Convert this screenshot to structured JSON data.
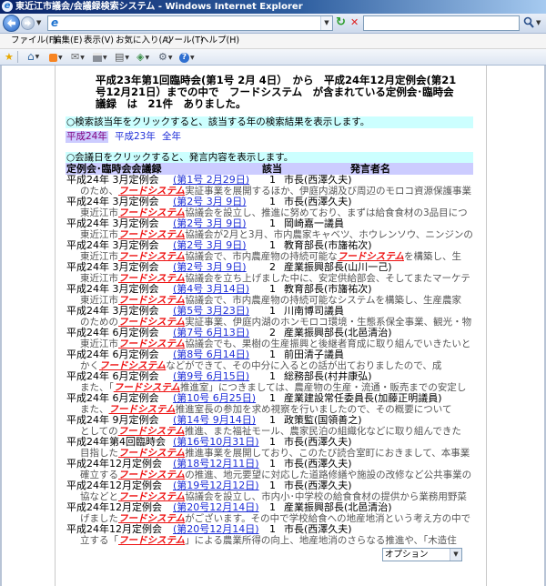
{
  "window": {
    "title": "東近江市議会/会議録検索システム - Windows Internet Explorer"
  },
  "menu": {
    "items": [
      "ファイル(F)",
      "編集(E)",
      "表示(V)",
      "お気に入り(A)",
      "ツール(T)",
      "ヘルプ(H)"
    ]
  },
  "icons": {
    "address_bar": [
      "back-arrow-icon",
      "forward-arrow-icon",
      "ie-page-icon",
      "refresh-icon",
      "stop-icon",
      "search-icon"
    ],
    "command_bar": [
      "favorites-star-icon",
      "home-icon",
      "feeds-icon",
      "read-mail-icon",
      "print-icon",
      "page-icon",
      "safety-icon",
      "tools-icon",
      "help-icon"
    ]
  },
  "colors": {
    "title_bar": "#0a246a",
    "note_bg": "#ccffff",
    "header_bg": "#ccccff",
    "selected_year_bg": "#ccccff",
    "link": "#1f2fd8",
    "visited_link": "#800080",
    "keyword": "#ee1111",
    "snippet": "#555555"
  },
  "search": {
    "keyword": "フードシステム"
  },
  "summary": {
    "lines": [
      "平成23年第1回臨時会(第1号 2月 4日）　から　平成24年12月定例会(第21",
      "号12月21日）までの中で　フードシステム　が含まれている定例会･臨時会",
      "議録　は　21件　ありました。"
    ]
  },
  "year_filter": {
    "note": "○検索該当年をクリックすると、該当する年の検索結果を表示します。",
    "years": [
      {
        "label": "平成24年",
        "selected": true
      },
      {
        "label": "平成23年",
        "selected": false
      },
      {
        "label": "全年",
        "selected": false
      }
    ]
  },
  "results": {
    "note": "○会議日をクリックすると、発言内容を表示します。",
    "columns": [
      "定例会･臨時会会議録",
      "該当",
      "発言者名"
    ],
    "rows": [
      {
        "meeting": "平成24年 3月定例会",
        "date": "(第1号 2月29日)",
        "count": 1,
        "speaker": "市長(西澤久夫)",
        "snippet": "のため、フードシステム実証事業を展開するほか、伊庭内湖及び周辺のモロコ資源保護事業"
      },
      {
        "meeting": "平成24年 3月定例会",
        "date": "(第2号 3月 9日)",
        "count": 1,
        "speaker": "市長(西澤久夫)",
        "snippet": "東近江市フードシステム協議会を設立し、推進に努めており、まずは給食食材の3品目につ"
      },
      {
        "meeting": "平成24年 3月定例会",
        "date": "(第2号 3月 9日)",
        "count": 1,
        "speaker": "岡崎嘉一議員",
        "snippet": "東近江市フードシステム協議会が2月と3月、市内農家キャベツ、ホウレンソウ、ニンジンの"
      },
      {
        "meeting": "平成24年 3月定例会",
        "date": "(第2号 3月 9日)",
        "count": 1,
        "speaker": "教育部長(市旛祐次)",
        "snippet": "東近江市フードシステム協議会で、市内農産物の持続可能なフードシステムを構築し、生"
      },
      {
        "meeting": "平成24年 3月定例会",
        "date": "(第2号 3月 9日)",
        "count": 2,
        "speaker": "産業振興部長(山川一己)",
        "snippet": "東近江市フードシステム協議会を立ち上げました中に、安定供給部会、そしてまたマーケテ"
      },
      {
        "meeting": "平成24年 3月定例会",
        "date": "(第4号 3月14日)",
        "count": 1,
        "speaker": "教育部長(市旛祐次)",
        "snippet": "東近江市フードシステム協議会で、市内農産物の持続可能なシステムを構築し、生産農家"
      },
      {
        "meeting": "平成24年 3月定例会",
        "date": "(第5号 3月23日)",
        "count": 1,
        "speaker": "川南博司議員",
        "snippet": "のためのフードシステム実証事業、伊庭内湖のホンモロコ環境・生態系保全事業、観光・物"
      },
      {
        "meeting": "平成24年 6月定例会",
        "date": "(第7号 6月13日)",
        "count": 2,
        "speaker": "産業振興部長(北邑清治)",
        "snippet": "東近江市フードシステム協議会でも、果樹の生産振興と後継者育成に取り組んでいきたいと"
      },
      {
        "meeting": "平成24年 6月定例会",
        "date": "(第8号 6月14日)",
        "count": 1,
        "speaker": "前田清子議員",
        "snippet": "かくフードシステムなどができて、その中分に入るとの話が出ておりましたので、成"
      },
      {
        "meeting": "平成24年 6月定例会",
        "date": "(第9号 6月15日)",
        "count": 1,
        "speaker": "総務部長(村井康弘)",
        "snippet": "また、「フードシステム推進室」につきましては、農産物の生産・流通・販売までの安定し"
      },
      {
        "meeting": "平成24年 6月定例会",
        "date": "(第10号 6月25日)",
        "count": 1,
        "speaker": "産業建設常任委員長(加藤正明議員)",
        "snippet": "また、フードシステム推進室長の参加を求め視察を行いましたので、その概要について"
      },
      {
        "meeting": "平成24年 9月定例会",
        "date": "(第14号 9月14日)",
        "count": 1,
        "speaker": "政策監(国領善之)",
        "snippet": "としてのフードシステム推進、また福祉モール、農家民泊の組織化などに取り組んできた"
      },
      {
        "meeting": "平成24年第4回臨時会",
        "date": "(第16号10月31日)",
        "count": 1,
        "speaker": "市長(西澤久夫)",
        "snippet": "目指したフードシステム推進事業を展開しており、このたび読合室町におきまして、本事業"
      },
      {
        "meeting": "平成24年12月定例会",
        "date": "(第18号12月11日)",
        "count": 1,
        "speaker": "市長(西澤久夫)",
        "snippet": "確立するフードシステムの推進、地元要望に対応した道路修繕や施設の改修など公共事業の"
      },
      {
        "meeting": "平成24年12月定例会",
        "date": "(第19号12月12日)",
        "count": 1,
        "speaker": "市長(西澤久夫)",
        "snippet": "協などとフードシステム協議会を設立し、市内小･中学校の給食食材の提供から業務用野菜"
      },
      {
        "meeting": "平成24年12月定例会",
        "date": "(第20号12月14日)",
        "count": 1,
        "speaker": "産業振興部長(北邑清治)",
        "snippet": "げましたフードシステムがございます。その中で学校給食への地産地消という考え方の中で"
      },
      {
        "meeting": "平成24年12月定例会",
        "date": "(第20号12月14日)",
        "count": 1,
        "speaker": "市長(西澤久夫)",
        "snippet": "立する「フードシステム」による農業所得の向上、地産地消のさらなる推進や、「木造住"
      }
    ]
  },
  "options_select": {
    "selected": "オプション"
  }
}
